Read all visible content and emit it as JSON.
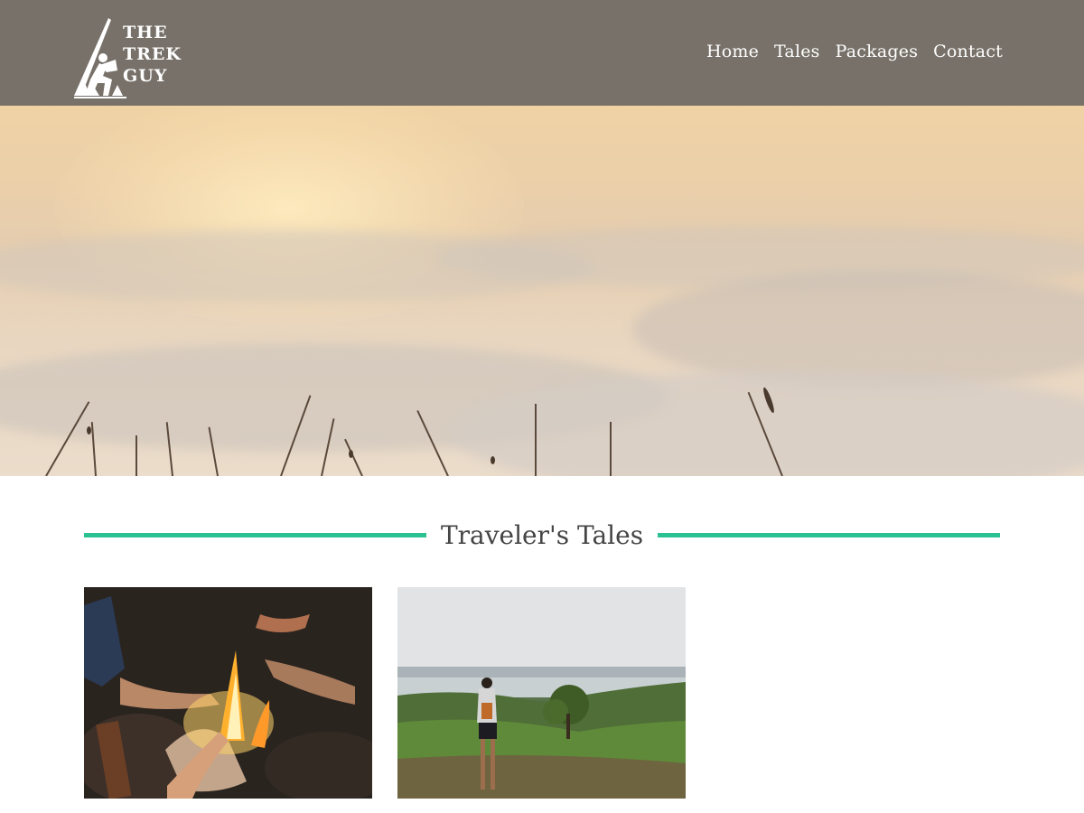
{
  "site": {
    "logo_lines": [
      "THE",
      "TREK",
      "GUY"
    ]
  },
  "nav": {
    "items": [
      {
        "label": "Home"
      },
      {
        "label": "Tales"
      },
      {
        "label": "Packages"
      },
      {
        "label": "Contact"
      }
    ]
  },
  "tales": {
    "heading": "Traveler's Tales",
    "accent_color": "#2bc192",
    "cards": [
      {
        "image": "campfire-hands-photo"
      },
      {
        "image": "hiker-overlooking-valley-photo"
      }
    ]
  },
  "colors": {
    "header_bg": "#6c6864",
    "heading_text": "#444444",
    "accent": "#2bc192"
  }
}
